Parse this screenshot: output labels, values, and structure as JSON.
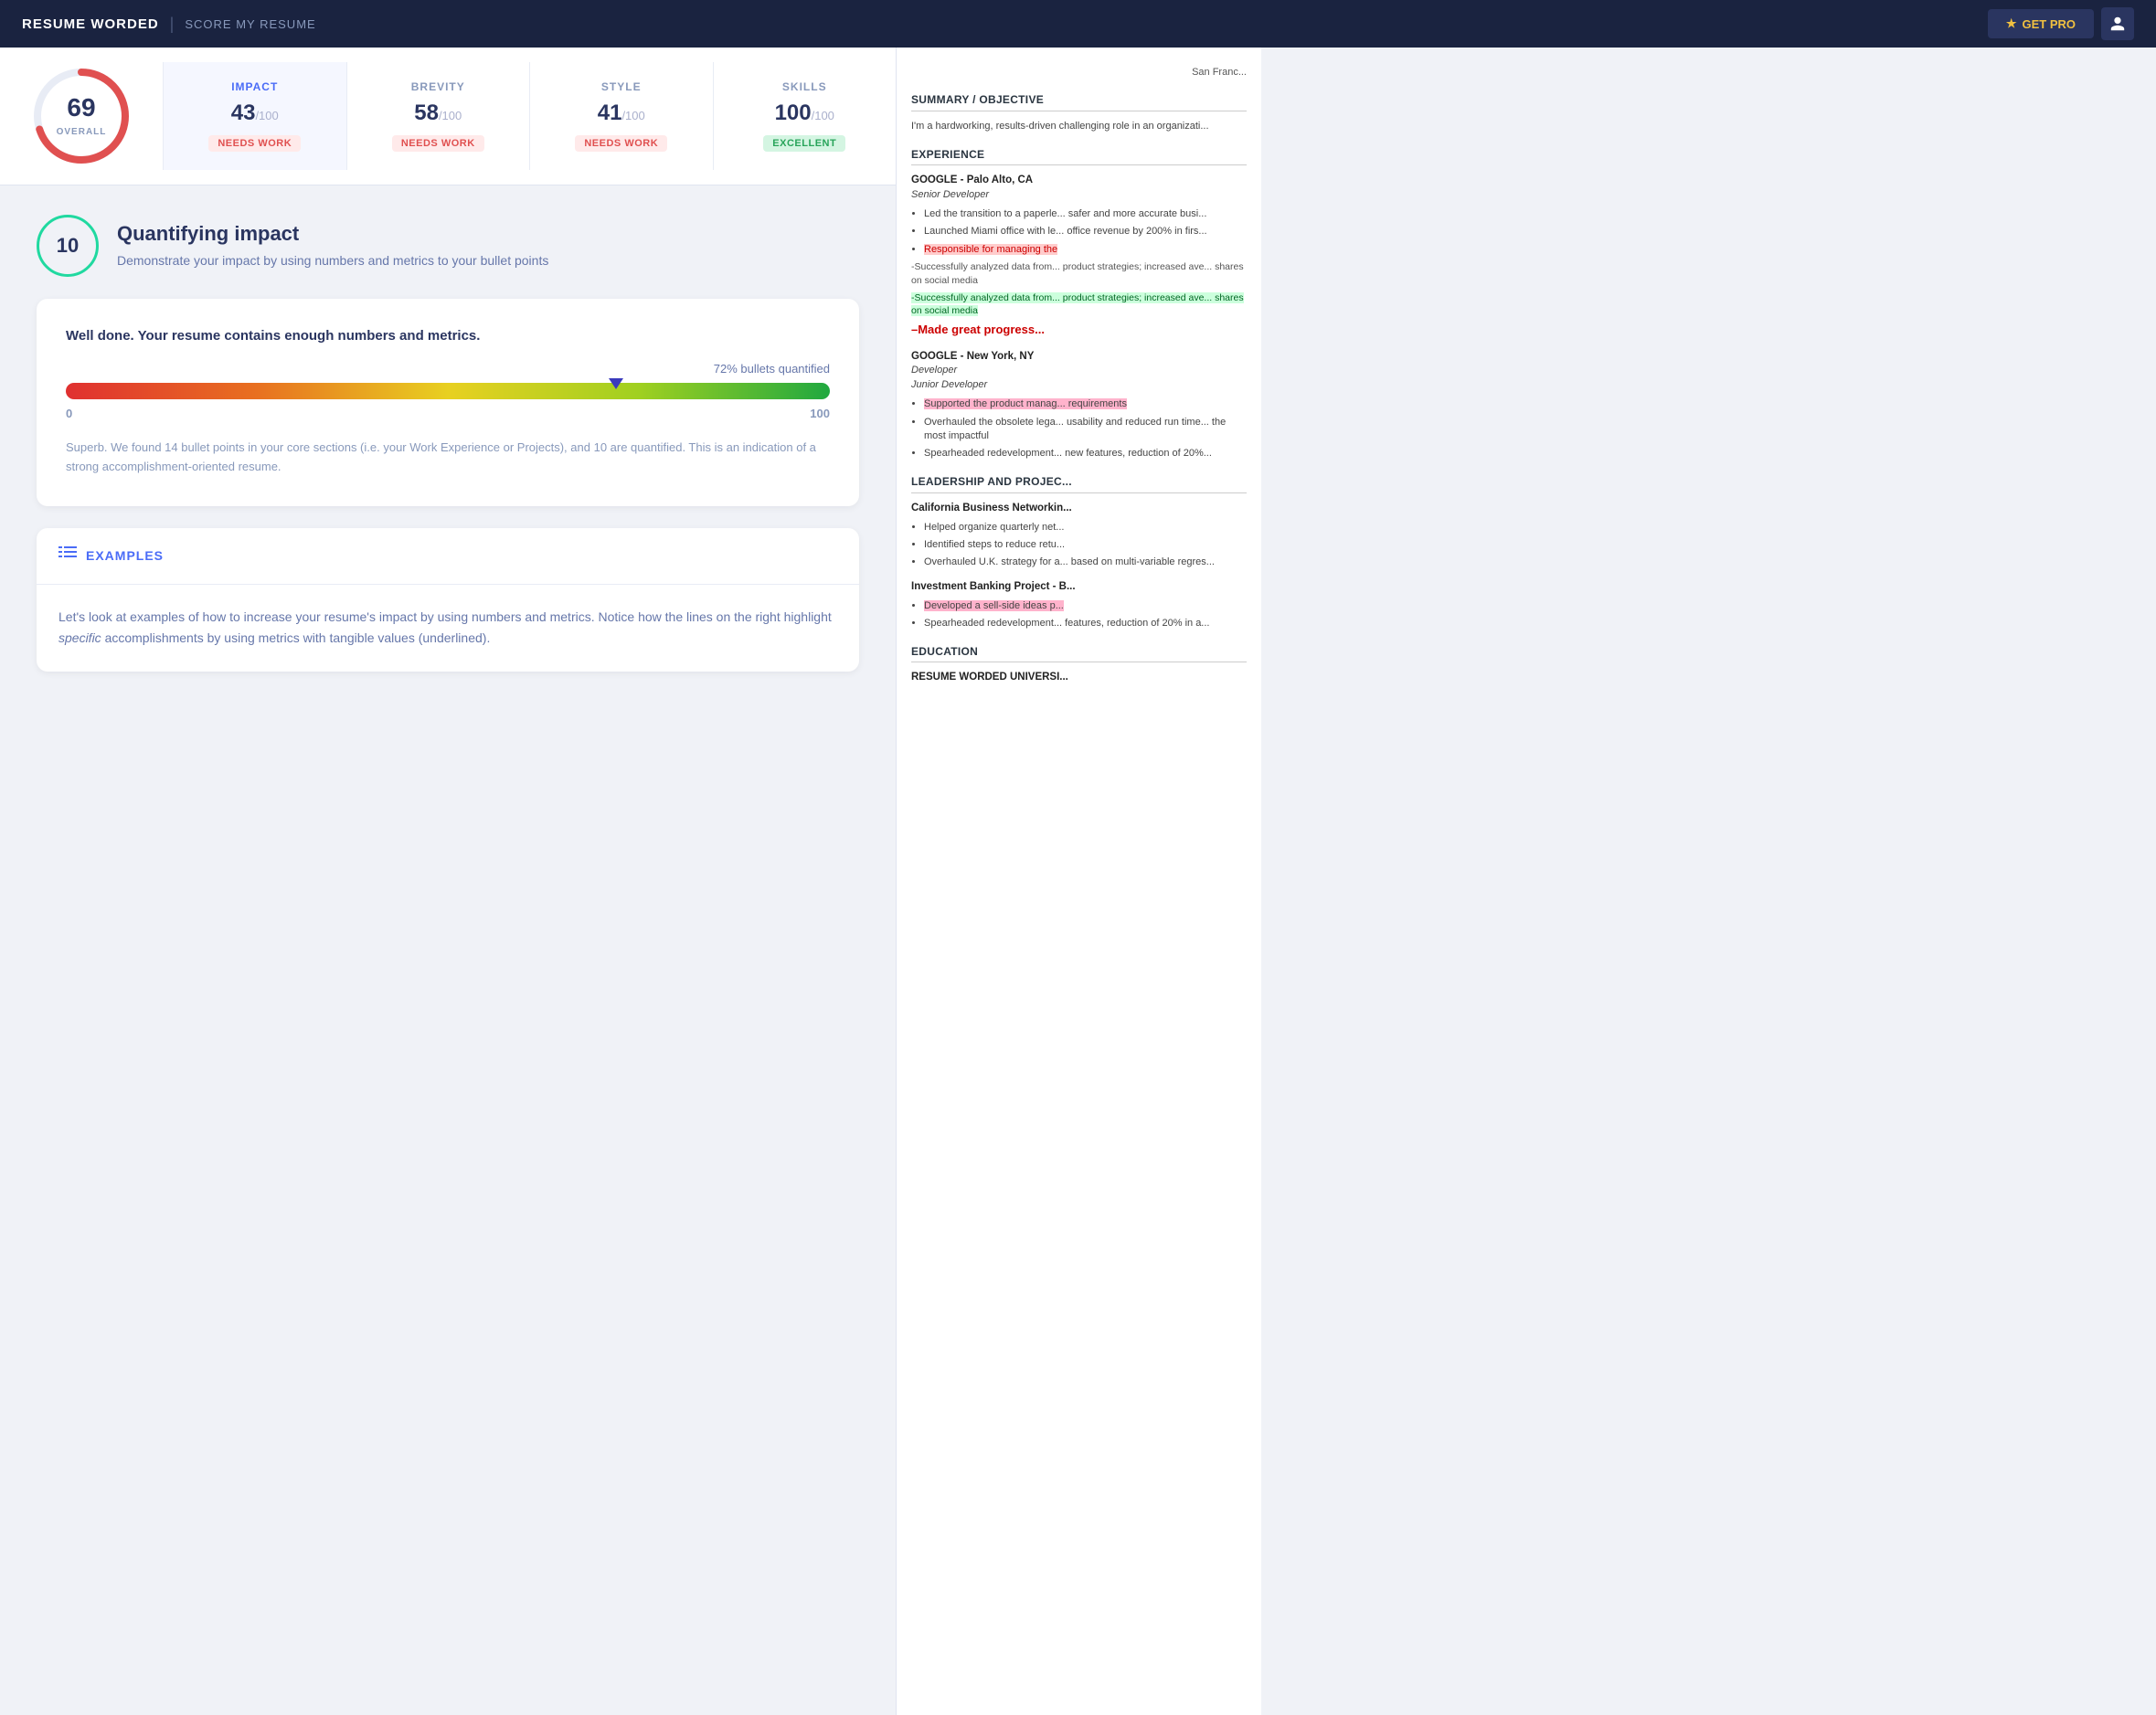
{
  "header": {
    "brand": "RESUME WORDED",
    "divider": "|",
    "nav_link": "SCORE MY RESUME",
    "get_pro_label": "GET PRO",
    "get_pro_star": "★"
  },
  "score_bar": {
    "overall": {
      "score": 69,
      "label": "OVERALL"
    },
    "categories": [
      {
        "name": "IMPACT",
        "score": "43",
        "denom": "/100",
        "badge": "NEEDS WORK",
        "badge_type": "needs-work",
        "active": true
      },
      {
        "name": "BREVITY",
        "score": "58",
        "denom": "/100",
        "badge": "NEEDS WORK",
        "badge_type": "needs-work",
        "active": false
      },
      {
        "name": "STYLE",
        "score": "41",
        "denom": "/100",
        "badge": "NEEDS WORK",
        "badge_type": "needs-work",
        "active": false
      },
      {
        "name": "SKILLS",
        "score": "100",
        "denom": "/100",
        "badge": "EXCELLENT",
        "badge_type": "excellent",
        "active": false
      }
    ]
  },
  "main_section": {
    "number": 10,
    "title": "Quantifying impact",
    "description": "Demonstrate your impact by using numbers and metrics to your bullet\npoints"
  },
  "well_done_card": {
    "title": "Well done. Your resume contains enough numbers and metrics.",
    "progress_label": "72% bullets quantified",
    "progress_percent": 72,
    "range_min": "0",
    "range_max": "100",
    "description": "Superb. We found 14 bullet points in your core sections (i.e. your Work Experience or Projects), and\n10 are quantified. This is an indication of a strong accomplishment-oriented resume."
  },
  "examples_section": {
    "title": "EXAMPLES",
    "body_text": "Let's look at examples of how to increase your resume's impact by using numbers and metrics. Notice how\nthe lines on the right highlight ",
    "body_italic": "specific",
    "body_text2": " accomplishments by using metrics with tangible values\n(underlined)."
  },
  "resume_preview": {
    "city": "San Franc...",
    "summary_title": "SUMMARY / OBJECTIVE",
    "summary_text": "I'm a hardworking, results-driven\nchallenging role in an organizati...",
    "experience_title": "EXPERIENCE",
    "jobs": [
      {
        "employer": "GOOGLE - Palo Alto, CA",
        "role": "Senior Developer",
        "bullets": [
          {
            "text": "Led the transition to a paperle... safer and more accurate busi...",
            "highlight": ""
          },
          {
            "text": "Launched Miami office with le... office revenue by 200% in firs...",
            "highlight": ""
          },
          {
            "text": "Responsible for managing the",
            "highlight": "red"
          },
          {
            "text": "-Successfully analyzed data from... product strategies; increased ave... shares on social media",
            "highlight": ""
          },
          {
            "text": "-Successfully analyzed data from... product strategies; increased ave... shares on social media",
            "highlight": "green"
          },
          {
            "text": "–Made great progress...",
            "highlight": "strikethrough"
          }
        ]
      },
      {
        "employer": "GOOGLE - New York, NY",
        "role": "Developer",
        "role2": "Junior Developer",
        "bullets": [
          {
            "text": "Supported the product manag... requirements",
            "highlight": "pink"
          },
          {
            "text": "Overhauled the obsolete lega... usability and reduced run time... the most impactful",
            "highlight": ""
          },
          {
            "text": "Spearheaded redevelopment... new features, reduction of 20%...",
            "highlight": ""
          }
        ]
      }
    ],
    "leadership_title": "LEADERSHIP AND PROJEC...",
    "leadership_items": [
      {
        "name": "California Business Networkin...",
        "bullets": [
          "Helped organize quarterly net...",
          "Identified steps to reduce retu...",
          "Overhauled U.K. strategy for a... based on multi-variable regres..."
        ]
      },
      {
        "name": "Investment Banking Project - B...",
        "bullets": [
          {
            "text": "Developed a sell-side ideas p...",
            "highlight": "pink"
          },
          {
            "text": "Spearheaded redevelopment... features, reduction of 20% in a...",
            "highlight": ""
          }
        ]
      }
    ],
    "education_title": "EDUCATION",
    "education_items": [
      {
        "name": "RESUME WORDED UNIVERSI..."
      }
    ]
  },
  "colors": {
    "accent_blue": "#4a6cf7",
    "accent_green": "#20d9a0",
    "dark_navy": "#1a2340",
    "text_dark": "#2a3560",
    "needs_work_bg": "#ffeaea",
    "needs_work_text": "#e05050",
    "excellent_bg": "#d4f5e2",
    "excellent_text": "#28a45a"
  }
}
